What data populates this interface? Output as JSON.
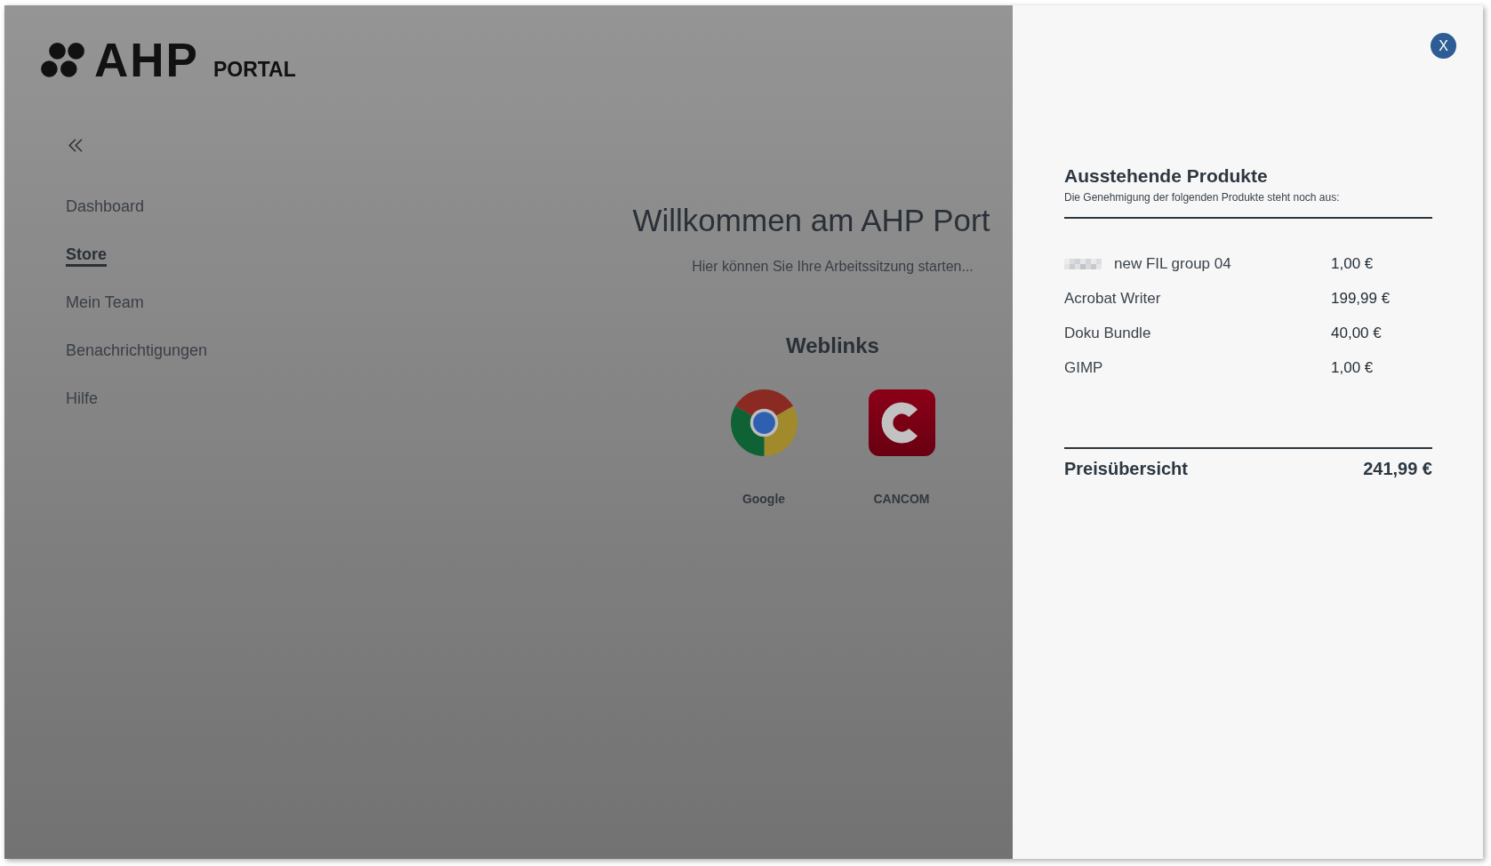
{
  "logo": {
    "wordmark": "AHP",
    "suffix": "PORTAL"
  },
  "sidebar": {
    "items": [
      {
        "label": "Dashboard",
        "selected": false
      },
      {
        "label": "Store",
        "selected": true
      },
      {
        "label": "Mein Team",
        "selected": false
      },
      {
        "label": "Benachrichtigungen",
        "selected": false
      },
      {
        "label": "Hilfe",
        "selected": false
      }
    ]
  },
  "main": {
    "title": "Willkommen am AHP Port",
    "subtitle": "Hier können Sie Ihre Arbeitssitzung starten...",
    "weblinks": {
      "heading": "Weblinks",
      "items": [
        {
          "label": "Google",
          "kind": "browser"
        },
        {
          "label": "CANCOM",
          "kind": "letter"
        }
      ]
    }
  },
  "drawer": {
    "close": "X",
    "title": "Ausstehende Produkte",
    "subtitle": "Die Genehmigung der folgenden Produkte steht noch aus:",
    "products": [
      {
        "name": "new FIL group 04",
        "price": "1,00 €",
        "redacted": true
      },
      {
        "name": "Acrobat Writer",
        "price": "199,99 €",
        "redacted": false
      },
      {
        "name": "Doku Bundle",
        "price": "40,00 €",
        "redacted": false
      },
      {
        "name": "GIMP",
        "price": "1,00 €",
        "redacted": false
      }
    ],
    "total": {
      "label": "Preisübersicht",
      "value": "241,99 €"
    }
  }
}
